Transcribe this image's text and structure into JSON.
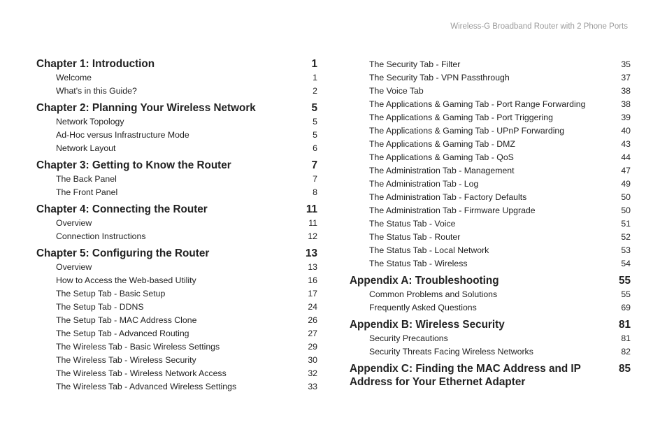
{
  "header": "Wireless-G Broadband Router with 2 Phone Ports",
  "columns": [
    {
      "items": [
        {
          "type": "chapter",
          "title": "Chapter 1: Introduction",
          "page": "1"
        },
        {
          "type": "sub",
          "title": "Welcome",
          "page": "1"
        },
        {
          "type": "sub",
          "title": "What's in this Guide?",
          "page": "2"
        },
        {
          "type": "chapter",
          "title": "Chapter 2: Planning Your Wireless Network",
          "page": "5"
        },
        {
          "type": "sub",
          "title": "Network Topology",
          "page": "5"
        },
        {
          "type": "sub",
          "title": "Ad-Hoc versus Infrastructure Mode",
          "page": "5"
        },
        {
          "type": "sub",
          "title": "Network Layout",
          "page": "6"
        },
        {
          "type": "chapter",
          "title": "Chapter 3: Getting to Know the Router",
          "page": "7"
        },
        {
          "type": "sub",
          "title": "The Back Panel",
          "page": "7"
        },
        {
          "type": "sub",
          "title": "The Front Panel",
          "page": "8"
        },
        {
          "type": "chapter",
          "title": "Chapter 4: Connecting the Router",
          "page": "11"
        },
        {
          "type": "sub",
          "title": "Overview",
          "page": "11"
        },
        {
          "type": "sub",
          "title": "Connection Instructions",
          "page": "12"
        },
        {
          "type": "chapter",
          "title": "Chapter 5: Configuring the Router",
          "page": "13"
        },
        {
          "type": "sub",
          "title": "Overview",
          "page": "13"
        },
        {
          "type": "sub",
          "title": "How to Access the Web-based Utility",
          "page": "16"
        },
        {
          "type": "sub",
          "title": "The Setup Tab - Basic Setup",
          "page": "17"
        },
        {
          "type": "sub",
          "title": "The Setup Tab - DDNS",
          "page": "24"
        },
        {
          "type": "sub",
          "title": "The Setup Tab - MAC Address Clone",
          "page": "26"
        },
        {
          "type": "sub",
          "title": "The Setup Tab - Advanced Routing",
          "page": "27"
        },
        {
          "type": "sub",
          "title": "The Wireless Tab - Basic Wireless Settings",
          "page": "29"
        },
        {
          "type": "sub",
          "title": "The Wireless Tab - Wireless Security",
          "page": "30"
        },
        {
          "type": "sub",
          "title": "The Wireless Tab - Wireless Network Access",
          "page": "32"
        },
        {
          "type": "sub",
          "title": "The Wireless Tab - Advanced Wireless Settings",
          "page": "33"
        }
      ]
    },
    {
      "items": [
        {
          "type": "sub",
          "title": "The Security Tab - Filter",
          "page": "35"
        },
        {
          "type": "sub",
          "title": "The Security Tab - VPN Passthrough",
          "page": "37"
        },
        {
          "type": "sub",
          "title": "The Voice Tab",
          "page": "38"
        },
        {
          "type": "sub",
          "title": "The Applications & Gaming Tab - Port Range Forwarding",
          "page": "38"
        },
        {
          "type": "sub",
          "title": "The Applications & Gaming Tab - Port Triggering",
          "page": "39"
        },
        {
          "type": "sub",
          "title": "The Applications & Gaming Tab - UPnP Forwarding",
          "page": "40"
        },
        {
          "type": "sub",
          "title": "The Applications & Gaming Tab - DMZ",
          "page": "43"
        },
        {
          "type": "sub",
          "title": "The Applications & Gaming Tab - QoS",
          "page": "44"
        },
        {
          "type": "sub",
          "title": "The Administration Tab - Management",
          "page": "47"
        },
        {
          "type": "sub",
          "title": "The Administration Tab - Log",
          "page": "49"
        },
        {
          "type": "sub",
          "title": "The Administration Tab - Factory Defaults",
          "page": "50"
        },
        {
          "type": "sub",
          "title": "The Administration Tab - Firmware Upgrade",
          "page": "50"
        },
        {
          "type": "sub",
          "title": "The Status Tab - Voice",
          "page": "51"
        },
        {
          "type": "sub",
          "title": "The Status Tab - Router",
          "page": "52"
        },
        {
          "type": "sub",
          "title": "The Status Tab - Local Network",
          "page": "53"
        },
        {
          "type": "sub",
          "title": "The Status Tab - Wireless",
          "page": "54"
        },
        {
          "type": "chapter",
          "title": "Appendix A: Troubleshooting",
          "page": "55"
        },
        {
          "type": "sub",
          "title": "Common Problems and Solutions",
          "page": "55"
        },
        {
          "type": "sub",
          "title": "Frequently Asked Questions",
          "page": "69"
        },
        {
          "type": "chapter",
          "title": "Appendix B: Wireless Security",
          "page": "81"
        },
        {
          "type": "sub",
          "title": "Security Precautions",
          "page": "81"
        },
        {
          "type": "sub",
          "title": "Security Threats Facing Wireless Networks",
          "page": "82"
        },
        {
          "type": "chapter",
          "title": "Appendix C: Finding the MAC Address and IP Address for Your Ethernet Adapter",
          "page": "85"
        }
      ]
    }
  ]
}
